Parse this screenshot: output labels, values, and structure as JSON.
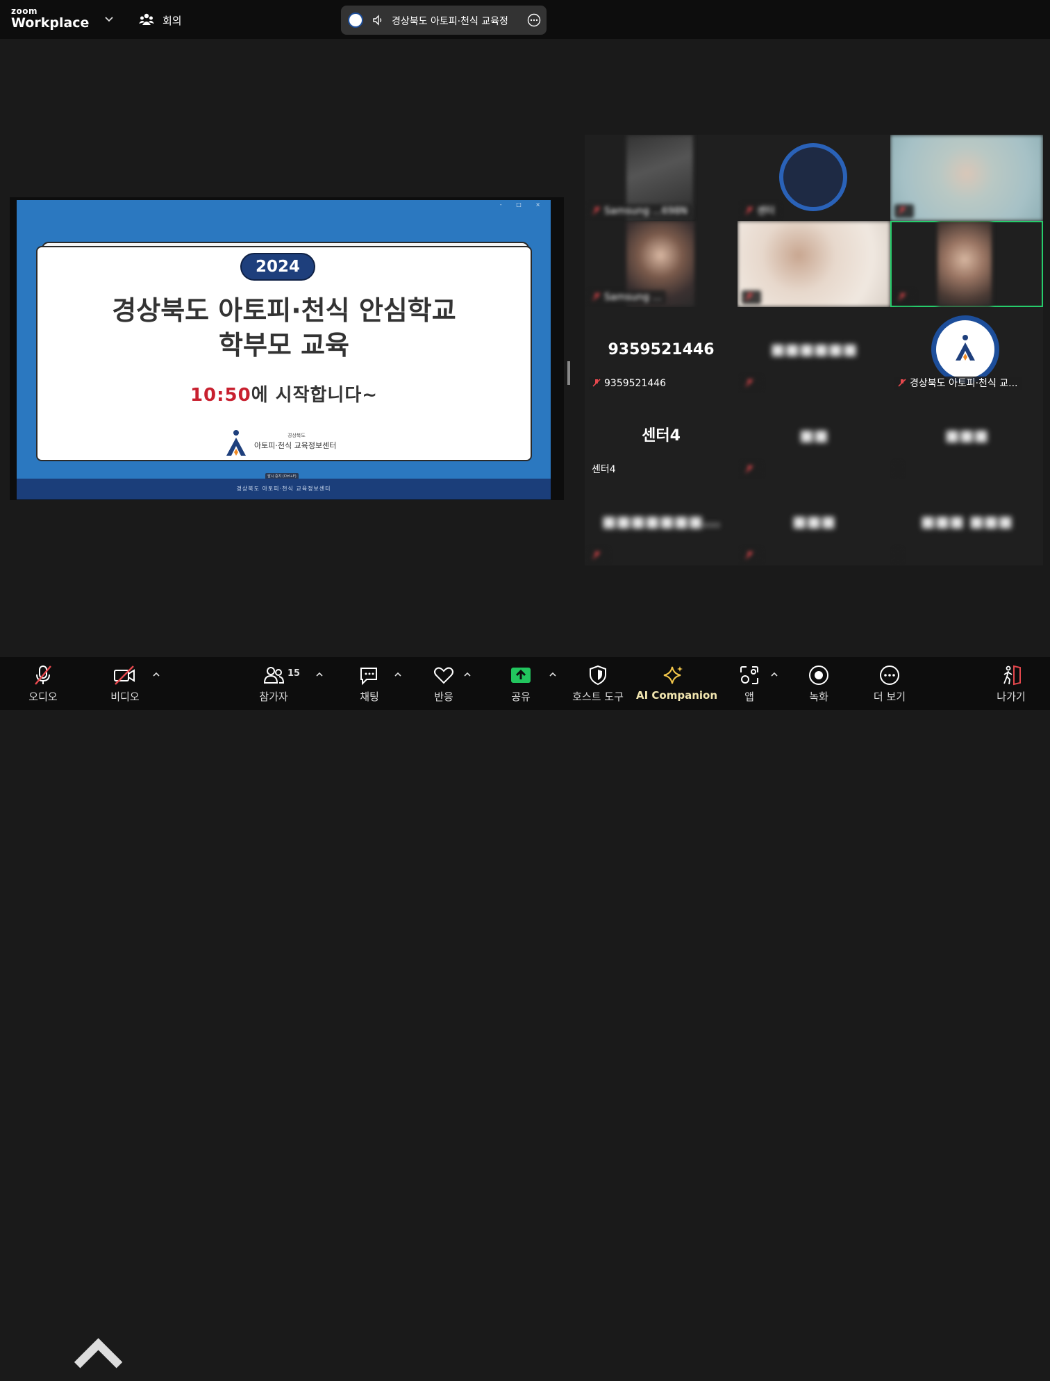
{
  "topbar": {
    "brand_small": "zoom",
    "brand_large": "Workplace",
    "meeting_label": "회의",
    "speaker_text": "경상북도 아토피·천식 교육정"
  },
  "slide": {
    "year": "2024",
    "title_line1": "경상북도 아토피·천식 안심학교",
    "title_line2": "학부모 교육",
    "start_time": "10:50",
    "start_text": "에  시작합니다~",
    "org_small": "경상북도",
    "org_name": "아토피·천식 교육정보센터",
    "hint": "발시 중지 (Ctrl+F)",
    "footer": "경상북도 아토피·천식 교육정보센터"
  },
  "gallery": {
    "tiles": [
      {
        "name": "Samsung ...698N",
        "big": "",
        "blur": true
      },
      {
        "name": "센터",
        "big": "",
        "blur": true
      },
      {
        "name": "",
        "big": "",
        "blur": true
      },
      {
        "name": "Samsung ...",
        "big": "",
        "blur": true
      },
      {
        "name": "",
        "big": "",
        "blur": true
      },
      {
        "name": "",
        "big": "",
        "blur": true
      },
      {
        "name": "9359521446",
        "big": "9359521446",
        "blur": false
      },
      {
        "name": "",
        "big": "",
        "blur": true
      },
      {
        "name": "경상북도 아토피·천식 교...",
        "big": "",
        "blur": false
      },
      {
        "name": "센터4",
        "big": "센터4",
        "blur": false
      },
      {
        "name": "",
        "big": "",
        "blur": true
      },
      {
        "name": "",
        "big": "",
        "blur": true
      },
      {
        "name": "",
        "big": "",
        "blur": true
      },
      {
        "name": "",
        "big": "",
        "blur": true
      },
      {
        "name": "",
        "big": "",
        "blur": true
      }
    ]
  },
  "toolbar": {
    "audio": "오디오",
    "video": "비디오",
    "participants": "참가자",
    "participants_count": "15",
    "chat": "채팅",
    "reactions": "반응",
    "share": "공유",
    "host_tools": "호스트 도구",
    "ai_companion": "AI Companion",
    "apps": "앱",
    "record": "녹화",
    "more": "더 보기",
    "leave": "나가기"
  },
  "colors": {
    "share_green": "#22c55e",
    "leave_red": "#e5484d",
    "active_speaker": "#26cc6b",
    "ai_yellow": "#f5c84b"
  }
}
